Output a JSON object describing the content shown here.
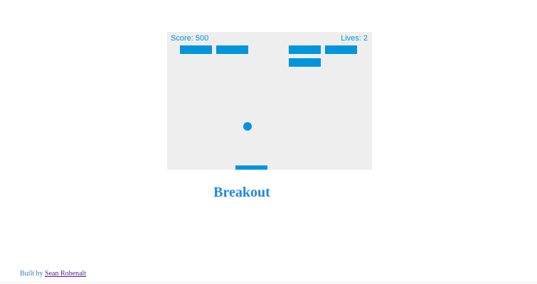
{
  "game": {
    "score_text": "Score: 500",
    "lives_text": "Lives: 2",
    "bricks_remaining": 5
  },
  "page": {
    "title": "Breakout",
    "footer_prefix": "Built by",
    "footer_author": "Sean Robenalt"
  },
  "colors": {
    "accent": "#0095dd",
    "canvas_background": "#eeeeee",
    "title": "#1e88e5"
  }
}
